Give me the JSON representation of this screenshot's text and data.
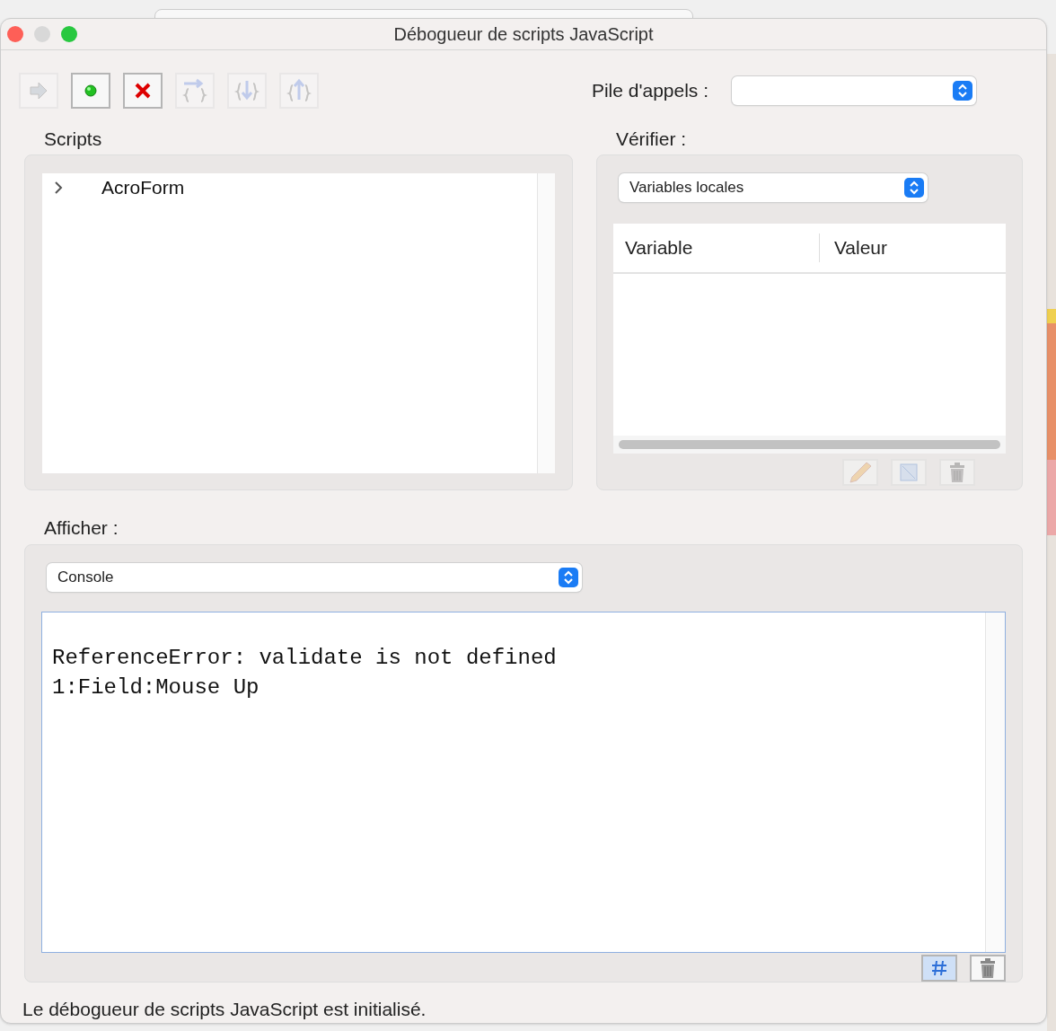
{
  "window": {
    "title": "Débogueur de scripts JavaScript"
  },
  "toolbar": [
    {
      "kind": "continue",
      "disabled": true
    },
    {
      "kind": "stop",
      "disabled": false
    },
    {
      "kind": "cancel",
      "disabled": false
    },
    {
      "kind": "step-over",
      "disabled": true
    },
    {
      "kind": "step-in",
      "disabled": true
    },
    {
      "kind": "step-out",
      "disabled": true
    }
  ],
  "call_stack": {
    "label": "Pile d'appels :"
  },
  "scripts": {
    "label": "Scripts",
    "items": [
      {
        "label": "AcroForm",
        "expanded": false
      }
    ]
  },
  "inspect": {
    "label": "Vérifier :",
    "select": "Variables locales",
    "columns": [
      "Variable",
      "Valeur"
    ],
    "buttons": [
      {
        "kind": "edit",
        "disabled": true
      },
      {
        "kind": "watch",
        "disabled": true
      },
      {
        "kind": "delete",
        "disabled": true
      }
    ]
  },
  "view": {
    "label": "Afficher :",
    "select": "Console",
    "lines": [
      "ReferenceError: validate is not defined",
      "1:Field:Mouse Up"
    ],
    "buttons": [
      {
        "kind": "breakpoint",
        "selected": true
      },
      {
        "kind": "clear",
        "selected": false
      }
    ]
  },
  "status_bar": "Le débogueur de scripts JavaScript est initialisé."
}
